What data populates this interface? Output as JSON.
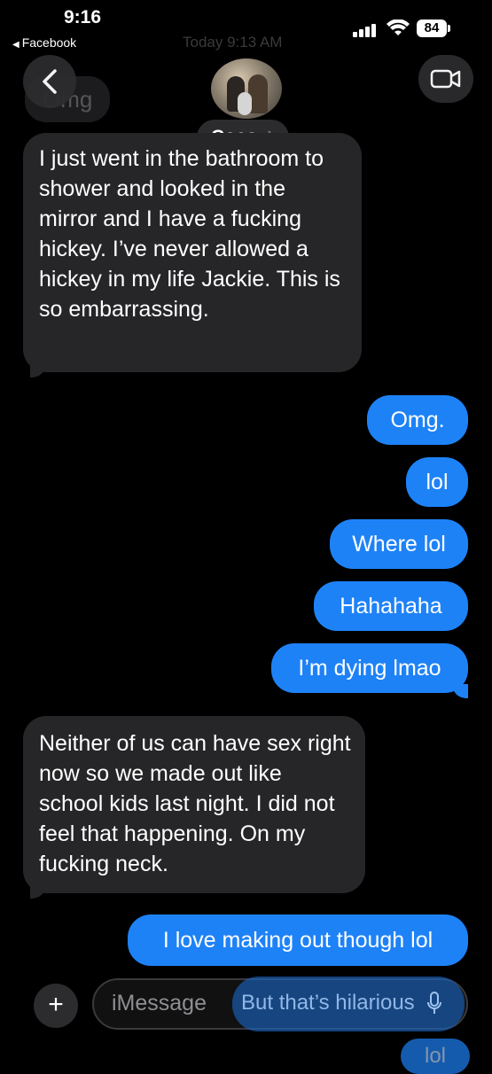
{
  "status_bar": {
    "time": "9:16",
    "back_app": "Facebook",
    "battery": "84"
  },
  "header": {
    "timestamp": "Today 9:13 AM",
    "contact_name": "Coco",
    "faded_prev_message": "Omg"
  },
  "messages": [
    {
      "dir": "in",
      "text": "I just went in the bathroom to shower and looked in the mirror and I have a fucking hickey. I’ve never allowed a hickey in my life Jackie. This is so embarrassing."
    },
    {
      "dir": "out",
      "text": "Omg."
    },
    {
      "dir": "out",
      "text": "lol"
    },
    {
      "dir": "out",
      "text": "Where lol"
    },
    {
      "dir": "out",
      "text": "Hahahaha"
    },
    {
      "dir": "out",
      "text": "I’m dying lmao"
    },
    {
      "dir": "in",
      "text": "Neither of us can have sex right now so we made out like school kids last night. I did not feel that happening. On my fucking neck."
    },
    {
      "dir": "out",
      "text": "I love making out though lol"
    }
  ],
  "input": {
    "placeholder": "iMessage",
    "ghost_text": "But that’s hilarious",
    "partial_bubble": "lol"
  },
  "colors": {
    "outgoing": "#1e82f7",
    "incoming": "#262628",
    "background": "#000000"
  },
  "icons": [
    "chevron-left-icon",
    "video-camera-icon",
    "plus-icon",
    "microphone-icon",
    "wifi-icon",
    "signal-icon",
    "battery-icon"
  ]
}
